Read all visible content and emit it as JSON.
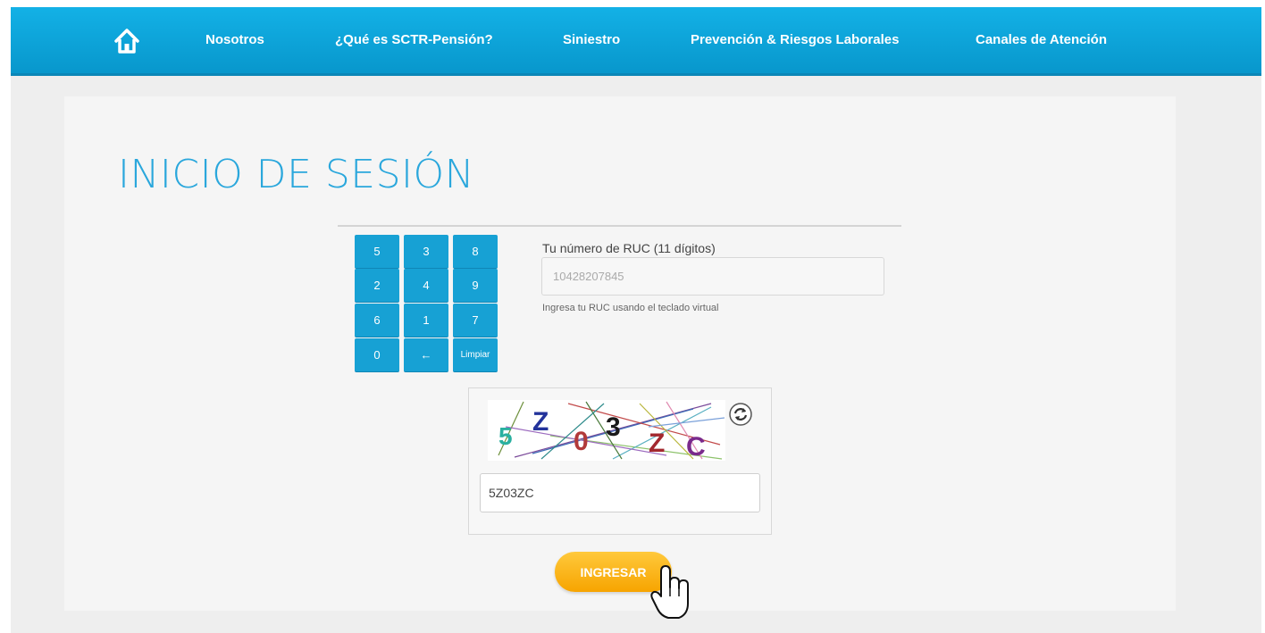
{
  "nav": {
    "home_icon": "home-icon",
    "links": [
      "Nosotros",
      "¿Qué es SCTR-Pensión?",
      "Siniestro",
      "Prevención & Riesgos Laborales",
      "Canales de Atención"
    ]
  },
  "login": {
    "title": "INICIO DE SESIÓN",
    "keypad": [
      "5",
      "3",
      "8",
      "2",
      "4",
      "9",
      "6",
      "1",
      "7",
      "0",
      "←",
      "Limpiar"
    ],
    "ruc_label": "Tu número de RUC (11 dígitos)",
    "ruc_value": "10428207845",
    "ruc_help": "Ingresa tu RUC usando el teclado virtual",
    "captcha_chars": [
      "5",
      "Z",
      "0",
      "3",
      "Z",
      "C"
    ],
    "captcha_value": "5Z03ZC",
    "submit_label": "INGRESAR"
  },
  "colors": {
    "nav_blue": "#13b1e6",
    "title_blue": "#2aa7dc",
    "key_blue": "#17a1d4",
    "submit_orange": "#f7a400"
  }
}
